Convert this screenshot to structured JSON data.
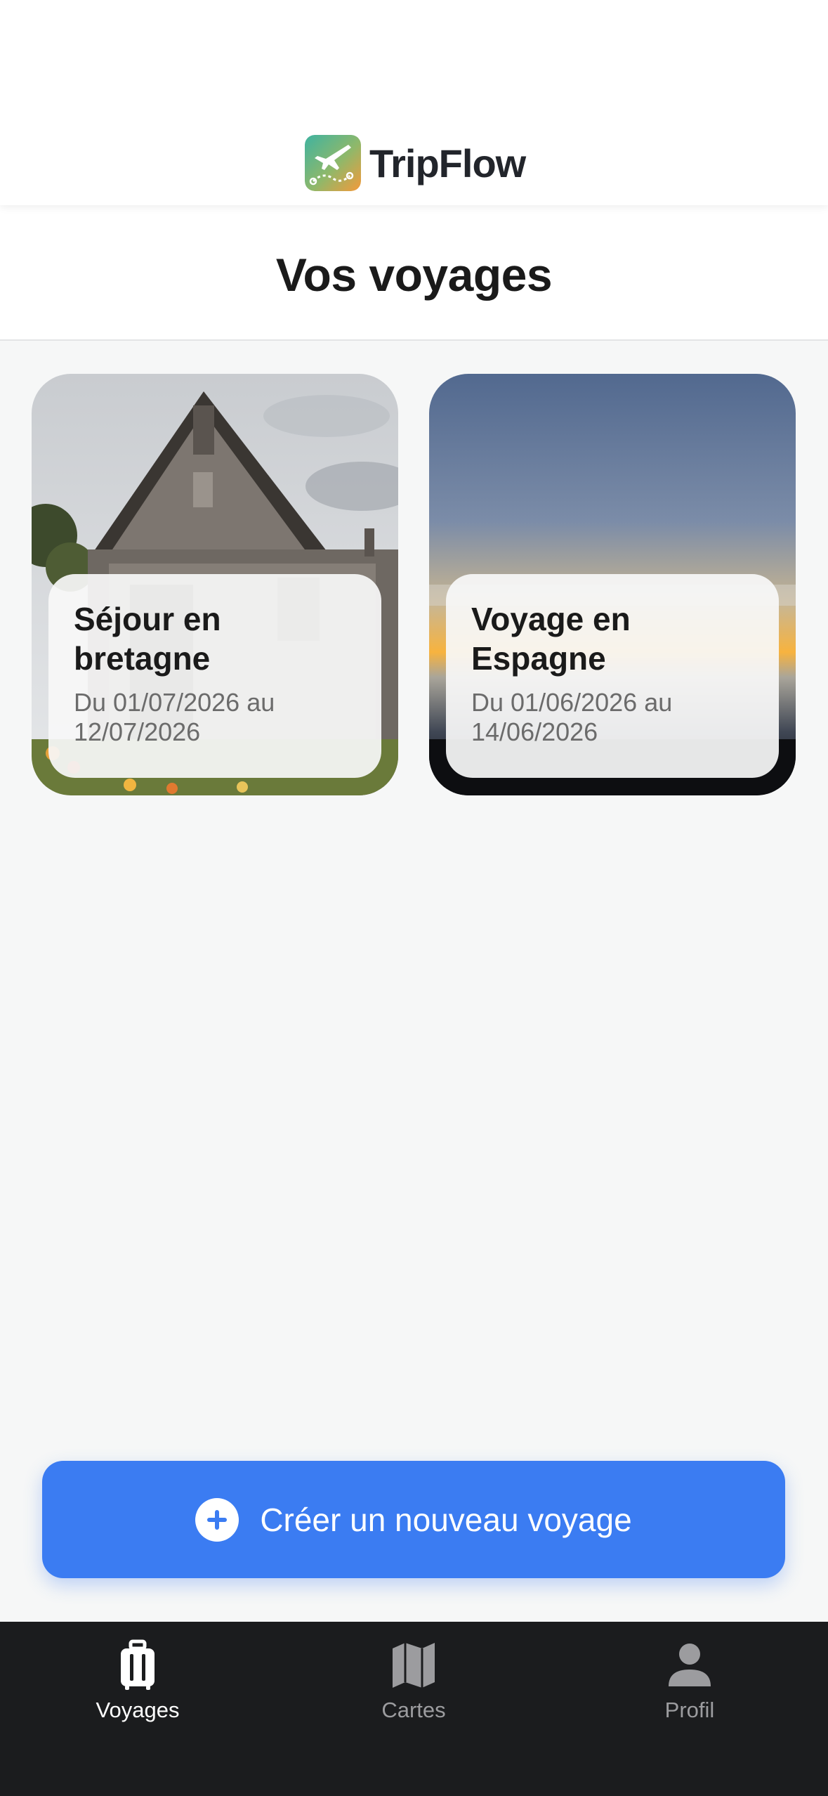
{
  "header": {
    "app_name": "TripFlow",
    "logo_icon": "airplane-route-icon"
  },
  "page": {
    "title": "Vos voyages"
  },
  "trips": [
    {
      "name_line1": "Séjour en",
      "name_line2": "bretagne",
      "dates_line1": "Du 01/07/2026 au",
      "dates_line2": "12/07/2026",
      "image": "stone-house-photo"
    },
    {
      "name_line1": "Voyage en",
      "name_line2": "Espagne",
      "dates_line1": "Du 01/06/2026 au",
      "dates_line2": "14/06/2026",
      "image": "sunset-sea-photo"
    }
  ],
  "actions": {
    "create_label": "Créer un nouveau voyage",
    "create_icon": "plus-circle-icon"
  },
  "tabs": [
    {
      "label": "Voyages",
      "icon": "suitcase-icon",
      "active": true
    },
    {
      "label": "Cartes",
      "icon": "map-icon",
      "active": false
    },
    {
      "label": "Profil",
      "icon": "person-icon",
      "active": false
    }
  ],
  "colors": {
    "accent": "#3b7cf2",
    "tab_bar": "#1b1c1e",
    "background": "#f6f7f7"
  }
}
